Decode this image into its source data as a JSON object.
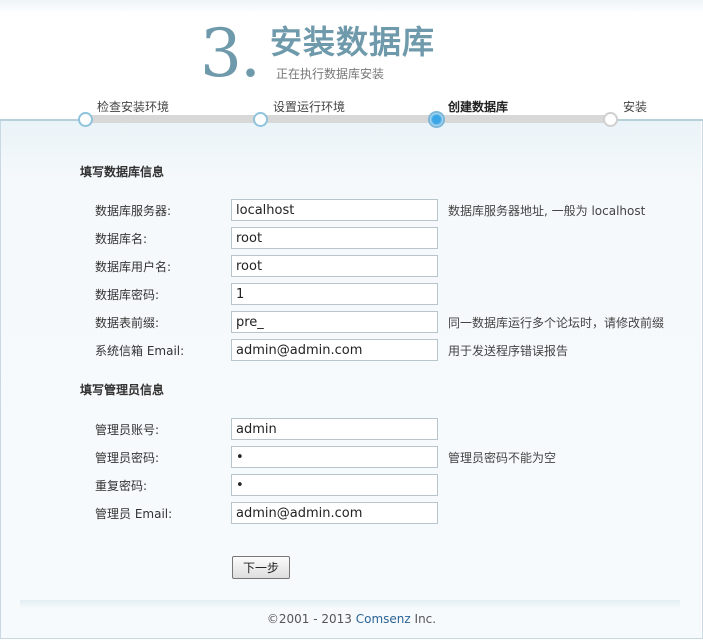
{
  "header": {
    "step_number": "3.",
    "title": "安装数据库",
    "subtitle": "正在执行数据库安装"
  },
  "steps": [
    {
      "label": "检查安装环境",
      "state": "done"
    },
    {
      "label": "设置运行环境",
      "state": "done"
    },
    {
      "label": "创建数据库",
      "state": "current"
    },
    {
      "label": "安装",
      "state": "pending"
    }
  ],
  "db_section": {
    "title": "填写数据库信息",
    "fields": [
      {
        "label": "数据库服务器:",
        "value": "localhost",
        "hint": "数据库服务器地址, 一般为 localhost"
      },
      {
        "label": "数据库名:",
        "value": "root",
        "hint": ""
      },
      {
        "label": "数据库用户名:",
        "value": "root",
        "hint": ""
      },
      {
        "label": "数据库密码:",
        "value": "1",
        "hint": ""
      },
      {
        "label": "数据表前缀:",
        "value": "pre_",
        "hint": "同一数据库运行多个论坛时，请修改前缀"
      },
      {
        "label": "系统信箱 Email:",
        "value": "admin@admin.com",
        "hint": "用于发送程序错误报告"
      }
    ]
  },
  "admin_section": {
    "title": "填写管理员信息",
    "fields": [
      {
        "label": "管理员账号:",
        "value": "admin",
        "hint": ""
      },
      {
        "label": "管理员密码:",
        "value": "•",
        "hint": "管理员密码不能为空"
      },
      {
        "label": "重复密码:",
        "value": "•",
        "hint": ""
      },
      {
        "label": "管理员 Email:",
        "value": "admin@admin.com",
        "hint": ""
      }
    ]
  },
  "actions": {
    "next_label": "下一步"
  },
  "footer": {
    "copyright": "©2001 - 2013 ",
    "brand": "Comsenz",
    "suffix": " Inc."
  },
  "colors": {
    "accent": "#6f9aab",
    "current_step": "#3aa6e6",
    "border": "#c9d9e2"
  }
}
